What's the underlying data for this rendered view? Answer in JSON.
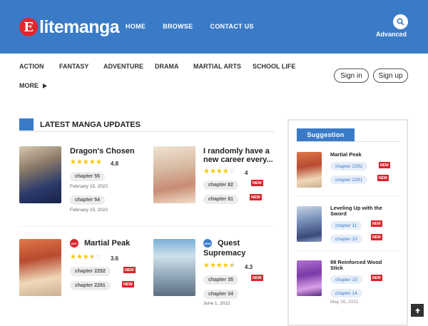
{
  "header": {
    "logo_letter": "E",
    "logo_text": "litemanga",
    "nav": [
      "HOME",
      "BROWSE",
      "CONTACT US"
    ],
    "advanced": "Advanced",
    "bg_color": "#3a7bc8"
  },
  "genres": [
    "ACTION",
    "FANTASY",
    "ADVENTURE",
    "DRAMA",
    "MARTIAL ARTS",
    "SCHOOL LIFE"
  ],
  "more": "MORE",
  "auth": {
    "sign_in": "Sign in",
    "sign_up": "Sign up"
  },
  "latest": {
    "title": "LATEST MANGA UPDATES",
    "items": [
      {
        "title": "Dragon's Chosen",
        "rating": "4.8",
        "stars": 5,
        "chapters": [
          {
            "label": "chapter 55",
            "date": "February 15, 2022"
          },
          {
            "label": "chapter 54",
            "date": "February 15, 2022"
          }
        ]
      },
      {
        "title": "I randomly have a new career every...",
        "rating": "4",
        "stars": 4,
        "chapters": [
          {
            "label": "chapter 82",
            "badge": "NEW"
          },
          {
            "label": "chapter 81",
            "badge": "NEW"
          }
        ]
      },
      {
        "title": "Martial Peak",
        "tag": "HOT",
        "rating": "3.6",
        "stars": 3.5,
        "chapters": [
          {
            "label": "chapter 2292",
            "badge": "NEW"
          },
          {
            "label": "chapter 2291",
            "badge": "NEW"
          }
        ]
      },
      {
        "title": "Quest Supremacy",
        "tag": "NEW",
        "rating": "4.3",
        "stars": 4.5,
        "chapters": [
          {
            "label": "chapter 35",
            "badge": "NEW"
          },
          {
            "label": "chapter 34",
            "date": "June 1, 2022"
          }
        ]
      }
    ]
  },
  "suggestion": {
    "title": "Suggestion",
    "items": [
      {
        "title": "Martial Peak",
        "chapters": [
          {
            "label": "chapter 2292",
            "badge": "NEW"
          },
          {
            "label": "chapter 2291",
            "badge": "NEW"
          }
        ]
      },
      {
        "title": "Leveling Up with the Sword",
        "chapters": [
          {
            "label": "chapter 11",
            "badge": "NEW"
          },
          {
            "label": "chapter 10",
            "badge": "NEW"
          }
        ]
      },
      {
        "title": "99 Reinforced Wood Stick",
        "chapters": [
          {
            "label": "chapter 15",
            "badge": "NEW"
          },
          {
            "label": "chapter 14",
            "date": "May 26, 2022"
          }
        ]
      }
    ]
  }
}
